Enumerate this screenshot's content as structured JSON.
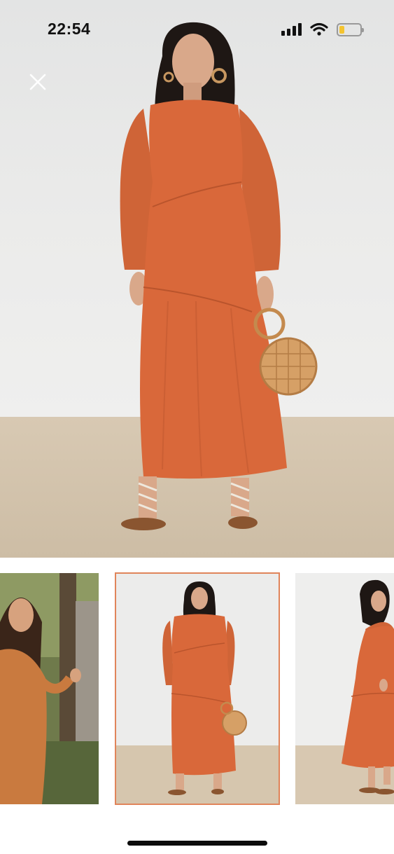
{
  "status_bar": {
    "time": "22:54",
    "icons": [
      "signal-icon",
      "wifi-icon",
      "battery-icon"
    ],
    "battery_level": 0.25,
    "battery_color": "#f4c430"
  },
  "viewer": {
    "close_icon": "close-icon",
    "main_image_desc": "model-dress-orange",
    "dress_color": "#d9683a",
    "thumbnails": [
      {
        "id": "outdoor",
        "selected": false
      },
      {
        "id": "studio-front",
        "selected": true
      },
      {
        "id": "studio-side",
        "selected": false
      }
    ],
    "selected_border_color": "#e0845a"
  }
}
